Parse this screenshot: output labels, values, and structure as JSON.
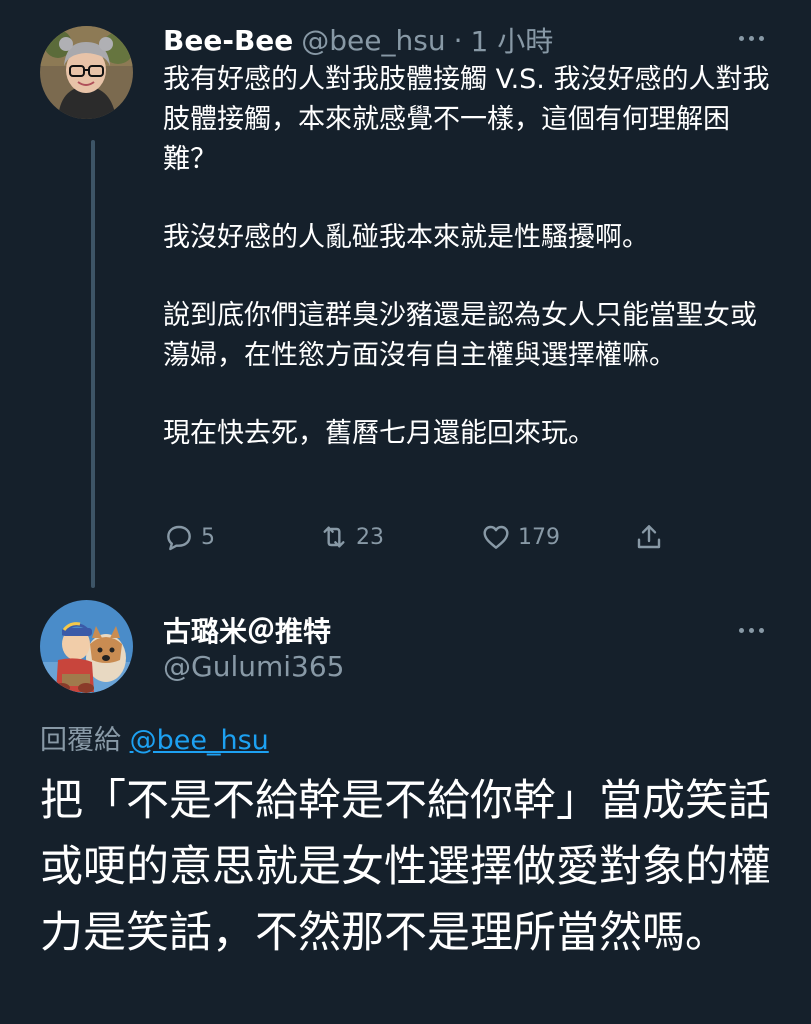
{
  "tweet1": {
    "name": "Bee-Bee",
    "handle": "@bee_hsu",
    "separator": "·",
    "time": "1 小時",
    "paragraphs": [
      "我有好感的人對我肢體接觸 V.S. 我沒好感的人對我肢體接觸，本來就感覺不一樣，這個有何理解困難？",
      "我沒好感的人亂碰我本來就是性騷擾啊。",
      "說到底你們這群臭沙豬還是認為女人只能當聖女或蕩婦，在性慾方面沒有自主權與選擇權嘛。",
      "現在快去死，舊曆七月還能回來玩。"
    ],
    "replies": "5",
    "retweets": "23",
    "likes": "179"
  },
  "tweet2": {
    "name": "古璐米＠推特",
    "handle": "@Gulumi365",
    "reply_prefix": "回覆給",
    "reply_mention": "@bee_hsu",
    "body": "把「不是不給幹是不給你幹」當成笑話或哽的意思就是女性選擇做愛對象的權力是笑話，不然那不是理所當然嗎。"
  },
  "colors": {
    "background": "#15202b",
    "text_primary": "#ffffff",
    "text_secondary": "#8899a6",
    "link": "#1da1f2",
    "thread_line": "#3d5466"
  },
  "icons": [
    "reply-icon",
    "retweet-icon",
    "like-icon",
    "share-icon",
    "more-icon"
  ]
}
